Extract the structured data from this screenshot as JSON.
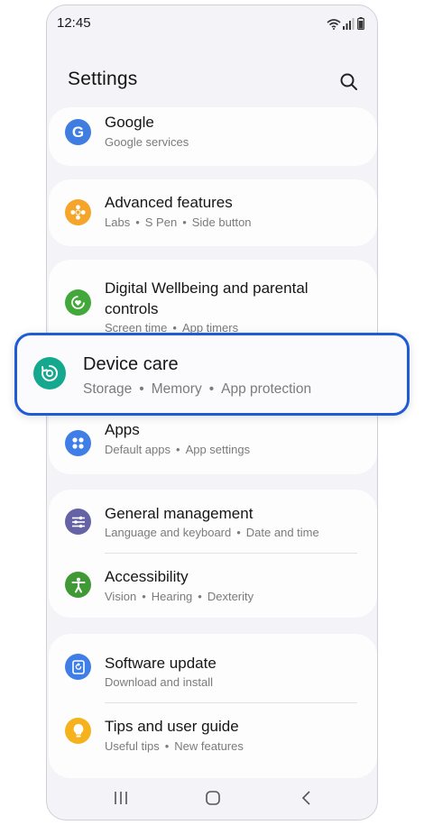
{
  "status": {
    "time": "12:45"
  },
  "header": {
    "title": "Settings"
  },
  "items": {
    "google": {
      "title": "Google",
      "subs": [
        "Google services"
      ]
    },
    "advanced": {
      "title": "Advanced features",
      "subs": [
        "Labs",
        "S Pen",
        "Side button"
      ]
    },
    "wellbeing": {
      "title_line1": "Digital Wellbeing and parental",
      "title_line2": "controls",
      "subs": [
        "Screen time",
        "App timers"
      ]
    },
    "device_care": {
      "title": "Device care",
      "subs": [
        "Storage",
        "Memory",
        "App protection"
      ]
    },
    "apps": {
      "title": "Apps",
      "subs": [
        "Default apps",
        "App settings"
      ]
    },
    "general": {
      "title": "General management",
      "subs": [
        "Language and keyboard",
        "Date and time"
      ]
    },
    "accessibility": {
      "title": "Accessibility",
      "subs": [
        "Vision",
        "Hearing",
        "Dexterity"
      ]
    },
    "software": {
      "title": "Software update",
      "subs": [
        "Download and install"
      ]
    },
    "tips": {
      "title": "Tips and user guide",
      "subs": [
        "Useful tips",
        "New features"
      ]
    }
  },
  "icons": {
    "google": "google-icon",
    "advanced": "advanced-features-icon",
    "wellbeing": "digital-wellbeing-icon",
    "device_care": "device-care-icon",
    "apps": "apps-icon",
    "general": "general-management-icon",
    "accessibility": "accessibility-icon",
    "software": "software-update-icon",
    "tips": "tips-lightbulb-icon"
  },
  "colors": {
    "google": "#3f7de0",
    "advanced": "#f4a52a",
    "wellbeing": "#43a83a",
    "device_care": "#14a98e",
    "apps": "#3e7ee6",
    "general": "#6662a6",
    "accessibility": "#3f9a35",
    "software": "#3e7ee6",
    "tips": "#f5b21d",
    "highlight_border": "#1f5bd6"
  }
}
